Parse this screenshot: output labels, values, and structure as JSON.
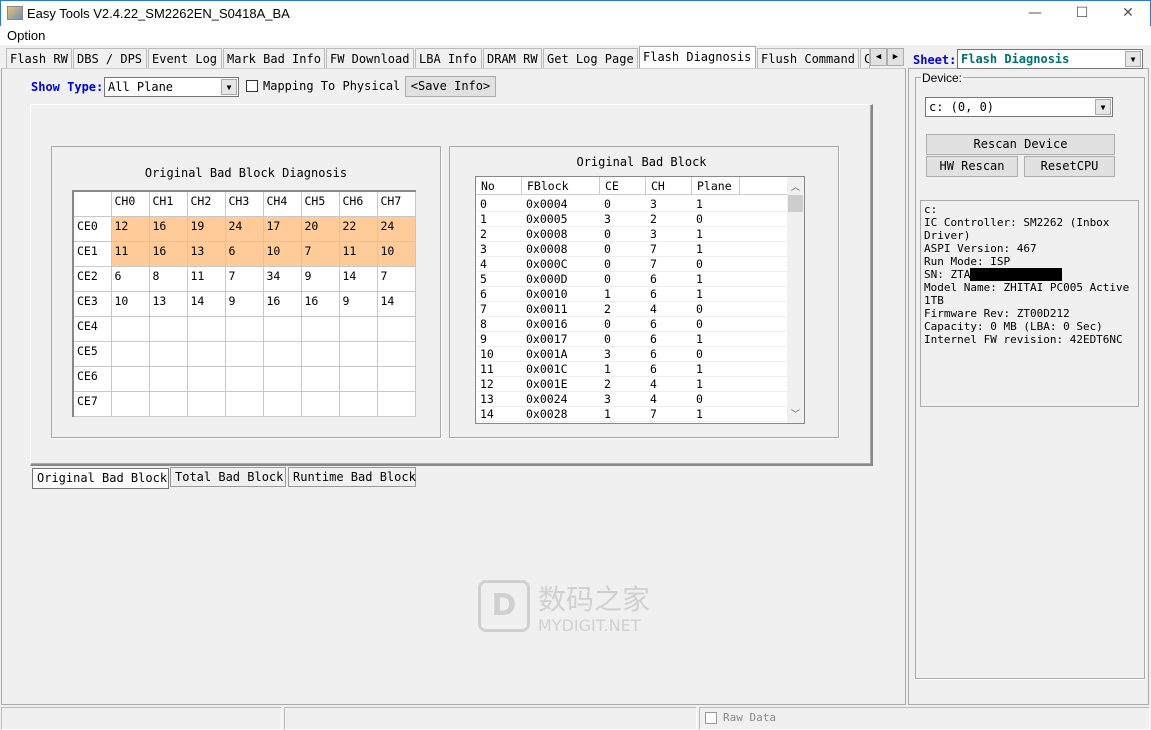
{
  "window": {
    "title": "Easy Tools V2.4.22_SM2262EN_S0418A_BA",
    "minimize": "—",
    "maximize": "☐",
    "close": "✕"
  },
  "menu": {
    "option": "Option"
  },
  "tabs": [
    {
      "label": "Flash RW"
    },
    {
      "label": "DBS / DPS"
    },
    {
      "label": "Event Log"
    },
    {
      "label": "Mark Bad Info"
    },
    {
      "label": "FW Download"
    },
    {
      "label": "LBA Info"
    },
    {
      "label": "DRAM RW"
    },
    {
      "label": "Get Log Page"
    },
    {
      "label": "Flash Diagnosis",
      "active": true
    },
    {
      "label": "Flush Command"
    },
    {
      "label": "C"
    }
  ],
  "toolbar": {
    "show_type_label": "Show Type:",
    "show_type_value": "All Plane",
    "mapping_label": "Mapping To Physical",
    "mapping_checked": false,
    "save_info": "<Save Info>"
  },
  "diagnosis": {
    "title": "Original Bad Block Diagnosis",
    "columns": [
      "CH0",
      "CH1",
      "CH2",
      "CH3",
      "CH4",
      "CH5",
      "CH6",
      "CH7"
    ],
    "rows": [
      {
        "ce": "CE0",
        "values": [
          "12",
          "16",
          "19",
          "24",
          "17",
          "20",
          "22",
          "24"
        ],
        "highlight": true
      },
      {
        "ce": "CE1",
        "values": [
          "11",
          "16",
          "13",
          "6",
          "10",
          "7",
          "11",
          "10"
        ],
        "highlight": true
      },
      {
        "ce": "CE2",
        "values": [
          "6",
          "8",
          "11",
          "7",
          "34",
          "9",
          "14",
          "7"
        ]
      },
      {
        "ce": "CE3",
        "values": [
          "10",
          "13",
          "14",
          "9",
          "16",
          "16",
          "9",
          "14"
        ]
      },
      {
        "ce": "CE4",
        "values": [
          "",
          "",
          "",
          "",
          "",
          "",
          "",
          ""
        ]
      },
      {
        "ce": "CE5",
        "values": [
          "",
          "",
          "",
          "",
          "",
          "",
          "",
          ""
        ]
      },
      {
        "ce": "CE6",
        "values": [
          "",
          "",
          "",
          "",
          "",
          "",
          "",
          ""
        ]
      },
      {
        "ce": "CE7",
        "values": [
          "",
          "",
          "",
          "",
          "",
          "",
          "",
          ""
        ]
      }
    ],
    "highlight_color": "#ffcc99"
  },
  "bad_block_list": {
    "title": "Original Bad Block",
    "columns": [
      "No",
      "FBlock",
      "CE",
      "CH",
      "Plane"
    ],
    "rows": [
      [
        "0",
        "0x0004",
        "0",
        "3",
        "1"
      ],
      [
        "1",
        "0x0005",
        "3",
        "2",
        "0"
      ],
      [
        "2",
        "0x0008",
        "0",
        "3",
        "1"
      ],
      [
        "3",
        "0x0008",
        "0",
        "7",
        "1"
      ],
      [
        "4",
        "0x000C",
        "0",
        "7",
        "0"
      ],
      [
        "5",
        "0x000D",
        "0",
        "6",
        "1"
      ],
      [
        "6",
        "0x0010",
        "1",
        "6",
        "1"
      ],
      [
        "7",
        "0x0011",
        "2",
        "4",
        "0"
      ],
      [
        "8",
        "0x0016",
        "0",
        "6",
        "0"
      ],
      [
        "9",
        "0x0017",
        "0",
        "6",
        "1"
      ],
      [
        "10",
        "0x001A",
        "3",
        "6",
        "0"
      ],
      [
        "11",
        "0x001C",
        "1",
        "6",
        "1"
      ],
      [
        "12",
        "0x001E",
        "2",
        "4",
        "1"
      ],
      [
        "13",
        "0x0024",
        "3",
        "4",
        "0"
      ],
      [
        "14",
        "0x0028",
        "1",
        "7",
        "1"
      ]
    ]
  },
  "bottom_tabs": [
    {
      "label": "Original Bad Block",
      "active": true
    },
    {
      "label": "Total Bad Block"
    },
    {
      "label": "Runtime Bad Block"
    }
  ],
  "sheet": {
    "label": "Sheet:",
    "value": "Flash Diagnosis"
  },
  "device": {
    "label": "Device:",
    "value": "c: (0, 0)",
    "rescan": "Rescan Device",
    "hw_rescan": "HW Rescan",
    "reset_cpu": "ResetCPU",
    "info": [
      "c:",
      "IC Controller: SM2262 (Inbox Driver)",
      "ASPI Version: 467",
      "Run Mode: ISP",
      "SN: ZTA",
      "Model Name: ZHITAI PC005 Active 1TB",
      "Firmware Rev: ZT00D212",
      "Capacity: 0 MB (LBA: 0 Sec)",
      "Internel FW revision: 42EDT6NC"
    ]
  },
  "status": {
    "raw_data": "Raw Data",
    "raw_data_checked": false
  },
  "watermark": {
    "cn": "数码之家",
    "en": "MYDIGIT.NET"
  }
}
